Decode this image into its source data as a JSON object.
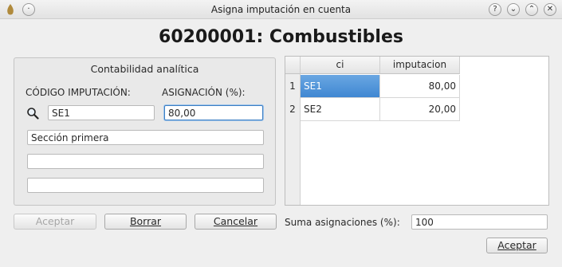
{
  "window": {
    "title": "Asigna imputación en cuenta",
    "controls": [
      "?",
      "⌄",
      "⌃",
      "✕"
    ]
  },
  "heading": "60200001: Combustibles",
  "panel": {
    "title": "Contabilidad analítica",
    "codigo_label": "CÓDIGO IMPUTACIÓN:",
    "asignacion_label": "ASIGNACIÓN (%):",
    "codigo_value": "SE1",
    "asignacion_value": "80,00",
    "descripcion_1": "Sección primera",
    "descripcion_2": "",
    "descripcion_3": ""
  },
  "buttons": {
    "aceptar_left": "Aceptar",
    "borrar": "Borrar",
    "cancelar": "Cancelar",
    "aceptar_right": "Aceptar"
  },
  "table": {
    "columns": [
      "ci",
      "imputacion"
    ],
    "rows": [
      {
        "num": "1",
        "ci": "SE1",
        "imputacion": "80,00",
        "selected": true
      },
      {
        "num": "2",
        "ci": "SE2",
        "imputacion": "20,00",
        "selected": false
      }
    ]
  },
  "summary": {
    "label": "Suma asignaciones (%):",
    "value": "100"
  },
  "colors": {
    "selection": "#4a8fd6",
    "focus_border": "#3d7fc4"
  }
}
